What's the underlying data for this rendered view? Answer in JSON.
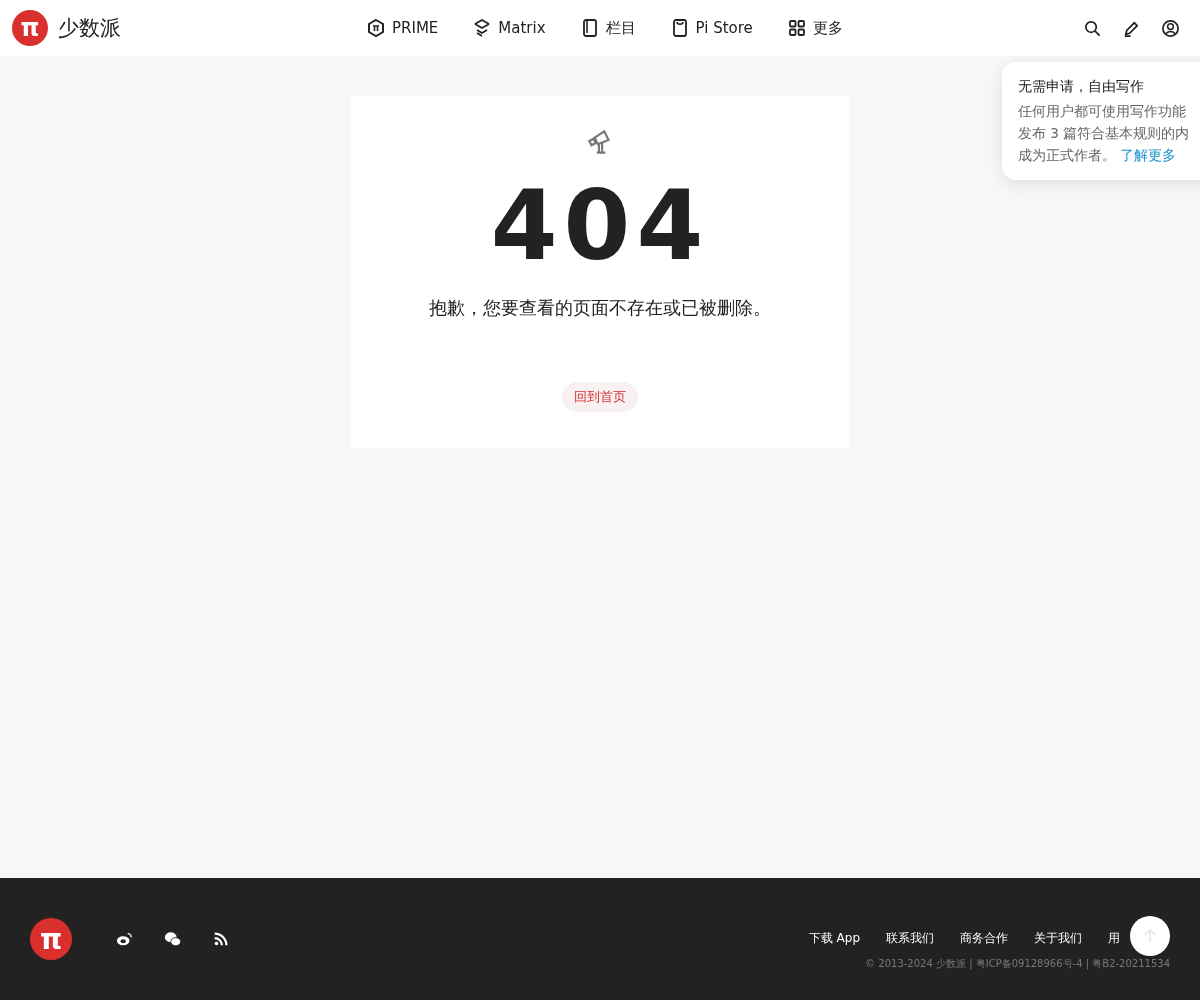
{
  "header": {
    "logo": "π",
    "site_name": "少数派",
    "nav": [
      {
        "label": "PRIME",
        "kind": "prime"
      },
      {
        "label": "Matrix",
        "kind": "matrix"
      },
      {
        "label": "栏目",
        "kind": "column"
      },
      {
        "label": "Pi Store",
        "kind": "store"
      },
      {
        "label": "更多",
        "kind": "more"
      }
    ]
  },
  "popover": {
    "title": "无需申请，自由写作",
    "lines": [
      "任何用户都可使用写作功能",
      "发布 3 篇符合基本规则的内"
    ],
    "last_line": "成为正式作者。",
    "link": "了解更多"
  },
  "error": {
    "code": "404",
    "message": "抱歉，您要查看的页面不存在或已被删除。",
    "button": "回到首页"
  },
  "footer": {
    "logo": "π",
    "socials": [
      {
        "kind": "weibo"
      },
      {
        "kind": "wechat"
      },
      {
        "kind": "rss"
      }
    ],
    "links": [
      "下载 App",
      "联系我们",
      "商务合作",
      "关于我们",
      "用"
    ],
    "copyright": "© 2013-2024 少数派 | 粤ICP备09128966号-4 | 粤B2-20211534"
  }
}
